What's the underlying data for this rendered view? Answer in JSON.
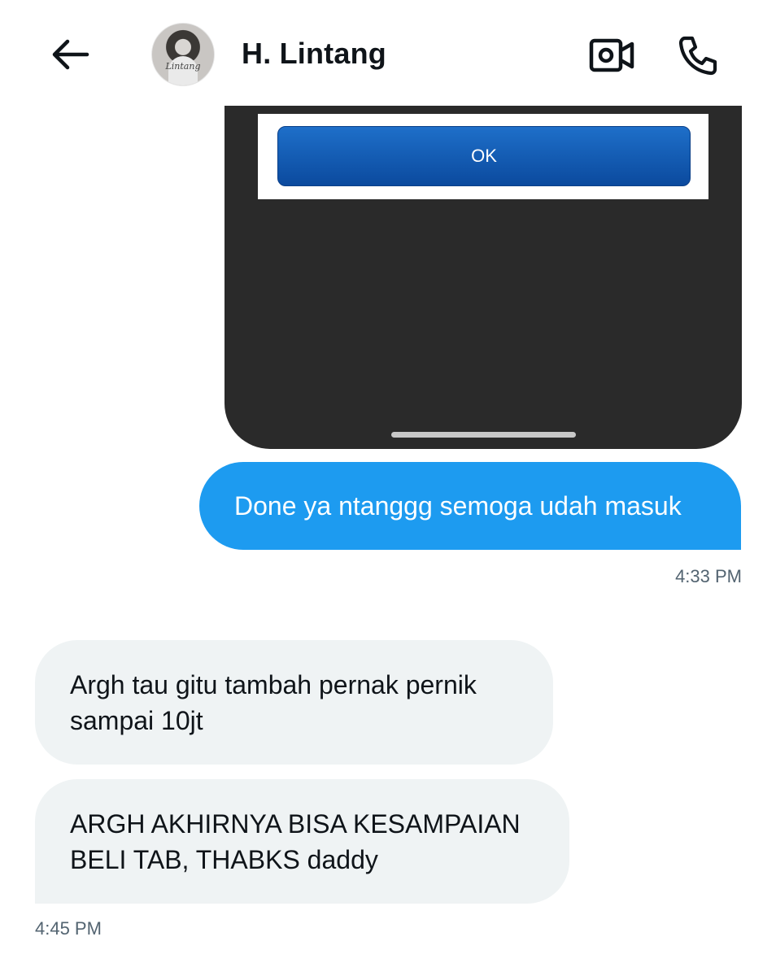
{
  "header": {
    "title": "H. Lintang",
    "avatar_logo": "Lintang",
    "icons": {
      "back": "arrow-left-icon",
      "video": "video-camera-icon",
      "call": "phone-icon"
    }
  },
  "attachment": {
    "button_label": "OK"
  },
  "messages": [
    {
      "direction": "sent",
      "text": "Done ya ntanggg semoga udah masuk",
      "time": "4:33 PM"
    },
    {
      "direction": "received",
      "text": "Argh tau gitu  tambah pernak pernik sampai 10jt"
    },
    {
      "direction": "received",
      "text": "ARGH AKHIRNYA BISA KESAMPAIAN BELI TAB, THABKS daddy",
      "time": "4:45 PM"
    }
  ],
  "colors": {
    "sent_bubble": "#1d9bf0",
    "received_bubble": "#eff3f4",
    "timestamp": "#536471"
  }
}
